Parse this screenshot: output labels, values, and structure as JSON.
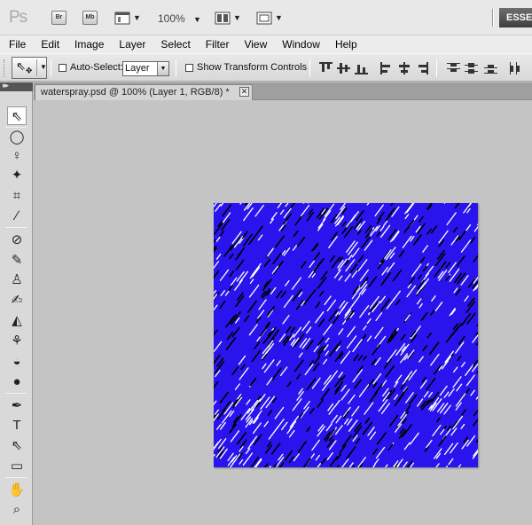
{
  "app": {
    "logo_text": "Ps",
    "bridge_label": "Br",
    "minibridge_label": "Mb",
    "zoom_level": "100%",
    "workspace_label": "ESSEN"
  },
  "menu": [
    "File",
    "Edit",
    "Image",
    "Layer",
    "Select",
    "Filter",
    "View",
    "Window",
    "Help"
  ],
  "options": {
    "auto_select_label": "Auto-Select:",
    "auto_select_value": "Layer",
    "auto_select_checked": false,
    "show_transform_label": "Show Transform Controls",
    "show_transform_checked": false
  },
  "document": {
    "tab_title": "waterspray.psd @ 100% (Layer 1, RGB/8) *",
    "canvas_colors": {
      "base": "#2a14ee",
      "streak_light": "#ffffff",
      "streak_dark": "#000000"
    }
  },
  "tools": [
    {
      "name": "move-tool-icon",
      "glyph": "⇖",
      "active": true
    },
    {
      "name": "elliptical-marquee-icon",
      "glyph": "◯"
    },
    {
      "name": "lasso-icon",
      "glyph": "♀"
    },
    {
      "name": "quick-selection-icon",
      "glyph": "✦"
    },
    {
      "name": "crop-icon",
      "glyph": "⌗"
    },
    {
      "name": "eyedropper-icon",
      "glyph": "∕"
    },
    {
      "name": "spot-healing-brush-icon",
      "glyph": "⊘"
    },
    {
      "name": "brush-icon",
      "glyph": "✎"
    },
    {
      "name": "clone-stamp-icon",
      "glyph": "♙"
    },
    {
      "name": "history-brush-icon",
      "glyph": "✍"
    },
    {
      "name": "eraser-icon",
      "glyph": "◭"
    },
    {
      "name": "paint-bucket-icon",
      "glyph": "⚘"
    },
    {
      "name": "blur-icon",
      "glyph": "◒"
    },
    {
      "name": "dodge-icon",
      "glyph": "●"
    },
    {
      "name": "pen-icon",
      "glyph": "✒"
    },
    {
      "name": "type-icon",
      "glyph": "T"
    },
    {
      "name": "path-selection-icon",
      "glyph": "⇖"
    },
    {
      "name": "rectangle-icon",
      "glyph": "▭"
    },
    {
      "name": "hand-icon",
      "glyph": "✋"
    },
    {
      "name": "zoom-icon",
      "glyph": "⌕"
    }
  ]
}
